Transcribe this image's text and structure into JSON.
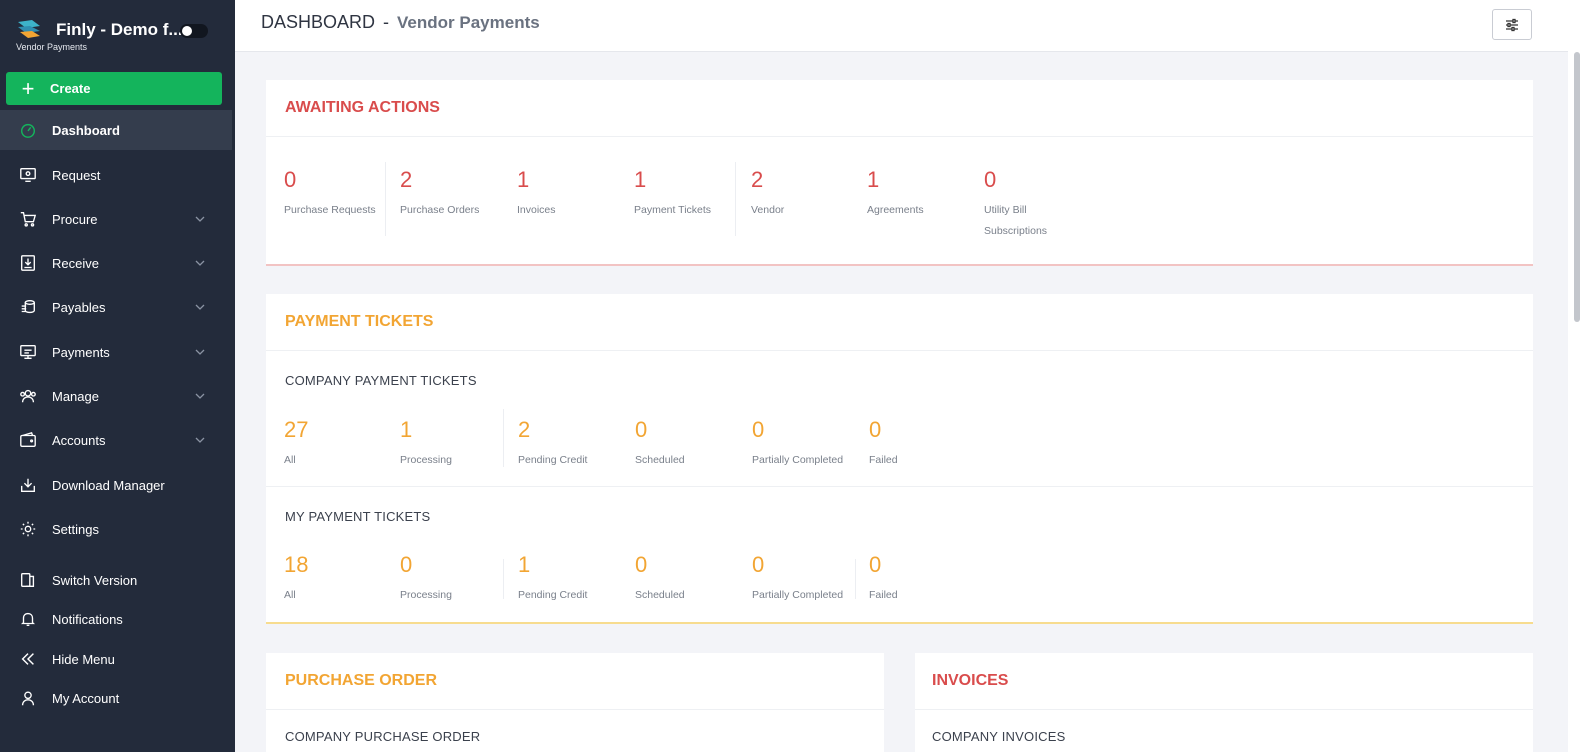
{
  "brand": {
    "title": "Finly - Demo f...",
    "subtitle": "Vendor Payments"
  },
  "sidebar": {
    "create_label": "Create",
    "items": [
      {
        "label": "Dashboard",
        "icon": "dashboard-icon"
      },
      {
        "label": "Request",
        "icon": "request-icon"
      },
      {
        "label": "Procure",
        "icon": "cart-icon"
      },
      {
        "label": "Receive",
        "icon": "receive-icon"
      },
      {
        "label": "Payables",
        "icon": "coins-icon"
      },
      {
        "label": "Payments",
        "icon": "payments-icon"
      },
      {
        "label": "Manage",
        "icon": "users-icon"
      },
      {
        "label": "Accounts",
        "icon": "wallet-icon"
      },
      {
        "label": "Download Manager",
        "icon": "download-icon"
      },
      {
        "label": "Settings",
        "icon": "gear-icon"
      }
    ],
    "bottom_items": [
      {
        "label": "Switch Version",
        "icon": "switch-icon"
      },
      {
        "label": "Notifications",
        "icon": "bell-icon"
      },
      {
        "label": "Hide Menu",
        "icon": "double-chevron-left-icon"
      },
      {
        "label": "My Account",
        "icon": "user-icon"
      }
    ]
  },
  "header": {
    "title": "DASHBOARD",
    "separator": "-",
    "subtitle": "Vendor Payments"
  },
  "awaiting": {
    "title": "AWAITING ACTIONS",
    "stats": [
      {
        "value": "0",
        "label": "Purchase Requests"
      },
      {
        "value": "2",
        "label": "Purchase Orders"
      },
      {
        "value": "1",
        "label": "Invoices"
      },
      {
        "value": "1",
        "label": "Payment Tickets"
      },
      {
        "value": "2",
        "label": "Vendor"
      },
      {
        "value": "1",
        "label": "Agreements"
      },
      {
        "value": "0",
        "label": "Utility Bill Subscriptions"
      }
    ]
  },
  "tickets": {
    "title": "PAYMENT TICKETS",
    "company_title": "COMPANY PAYMENT TICKETS",
    "company": [
      {
        "value": "27",
        "label": "All"
      },
      {
        "value": "1",
        "label": "Processing"
      },
      {
        "value": "2",
        "label": "Pending Credit"
      },
      {
        "value": "0",
        "label": "Scheduled"
      },
      {
        "value": "0",
        "label": "Partially Completed"
      },
      {
        "value": "0",
        "label": "Failed"
      }
    ],
    "my_title": "MY PAYMENT TICKETS",
    "mine": [
      {
        "value": "18",
        "label": "All"
      },
      {
        "value": "0",
        "label": "Processing"
      },
      {
        "value": "1",
        "label": "Pending Credit"
      },
      {
        "value": "0",
        "label": "Scheduled"
      },
      {
        "value": "0",
        "label": "Partially Completed"
      },
      {
        "value": "0",
        "label": "Failed"
      }
    ]
  },
  "purchase_order": {
    "title": "PURCHASE ORDER",
    "company_title": "COMPANY PURCHASE ORDER"
  },
  "invoices": {
    "title": "INVOICES",
    "company_title": "COMPANY INVOICES"
  },
  "colors": {
    "sidebar": "#232b3b",
    "create": "#14b45c",
    "red": "#d94c4c",
    "amber": "#f2a533"
  }
}
